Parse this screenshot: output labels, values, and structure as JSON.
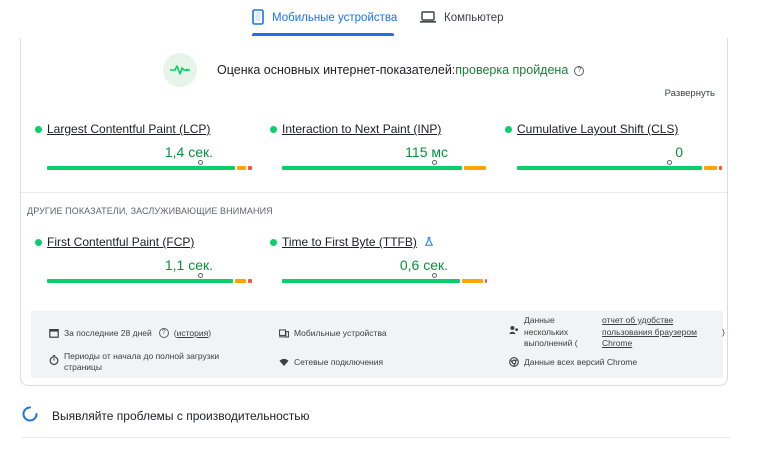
{
  "tabs": {
    "mobile_label": "Мобильные устройства",
    "desktop_label": "Компьютер"
  },
  "cwv": {
    "title": "Оценка основных интернет-показателей:",
    "status": "проверка пройдена",
    "expand_label": "Развернуть"
  },
  "metrics": [
    {
      "name": "Largest Contentful Paint (LCP)",
      "value": "1,4 сек."
    },
    {
      "name": "Interaction to Next Paint (INP)",
      "value": "115 мс"
    },
    {
      "name": "Cumulative Layout Shift (CLS)",
      "value": "0"
    }
  ],
  "other_section_label": "ДРУГИЕ ПОКАЗАТЕЛИ, ЗАСЛУЖИВАЮЩИЕ ВНИМАНИЯ",
  "other_metrics": [
    {
      "name": "First Contentful Paint (FCP)",
      "value": "1,1 сек."
    },
    {
      "name": "Time to First Byte (TTFB)",
      "value": "0,6 сек."
    }
  ],
  "info": {
    "period": "За последние 28 дней",
    "history_link": "история",
    "period_open": "(",
    "period_close": ")",
    "load_periods": "Периоды от начала до полной загрузки страницы",
    "device": "Мобильные устройства",
    "network": "Сетевые подключения",
    "data_source_prefix": "Данные нескольких выполнений (",
    "data_source_link": "отчет об удобстве пользования браузером Chrome",
    "data_source_suffix": ")",
    "chrome_versions": "Данные всех версий Chrome"
  },
  "diagnose": {
    "title": "Выявляйте проблемы с производительностью"
  },
  "colors": {
    "accent": "#1a73e8",
    "good": "#0cce6b",
    "needs_improvement": "#ffa400",
    "poor": "#ff4e42",
    "pass_text": "#188038"
  }
}
